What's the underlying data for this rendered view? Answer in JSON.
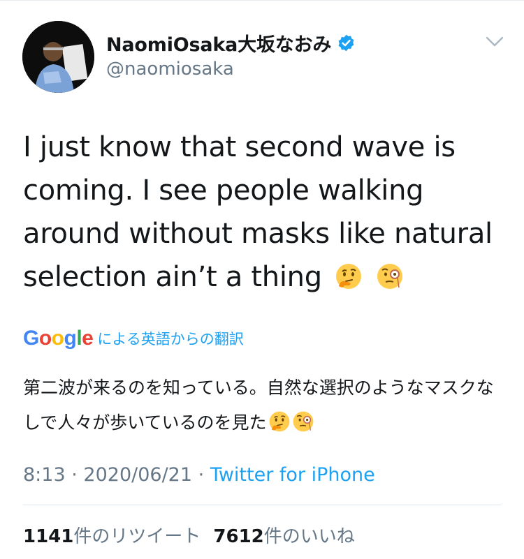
{
  "user": {
    "display_name": "NaomiOsaka大坂なおみ",
    "handle": "@naomiosaka"
  },
  "tweet": {
    "text": "I just know that second wave is coming. I see people walking around without masks like natural selection ain’t a thing"
  },
  "translation": {
    "google_letters": [
      "G",
      "o",
      "o",
      "g",
      "l",
      "e"
    ],
    "google_colors": [
      "#4285F4",
      "#EA4335",
      "#FBBC05",
      "#4285F4",
      "#34A853",
      "#EA4335"
    ],
    "label": "による英語からの翻訳",
    "text": "第二波が来るのを知っている。自然な選択のようなマスクなしで人々が歩いているのを見た"
  },
  "meta": {
    "time": "8:13",
    "separator": "·",
    "date": "2020/06/21",
    "source": "Twitter for iPhone"
  },
  "stats": {
    "retweets": "1141",
    "retweets_label": "件のリツイート",
    "likes": "7612",
    "likes_label": "件のいいね"
  },
  "icons": {
    "verified": "verified-badge-icon",
    "more": "chevron-down-icon",
    "emoji1": "thinking-face-emoji",
    "emoji2": "face-with-monocle-emoji"
  },
  "colors": {
    "accent": "#1da1f2",
    "secondary_text": "#657786",
    "primary_text": "#14171a"
  }
}
